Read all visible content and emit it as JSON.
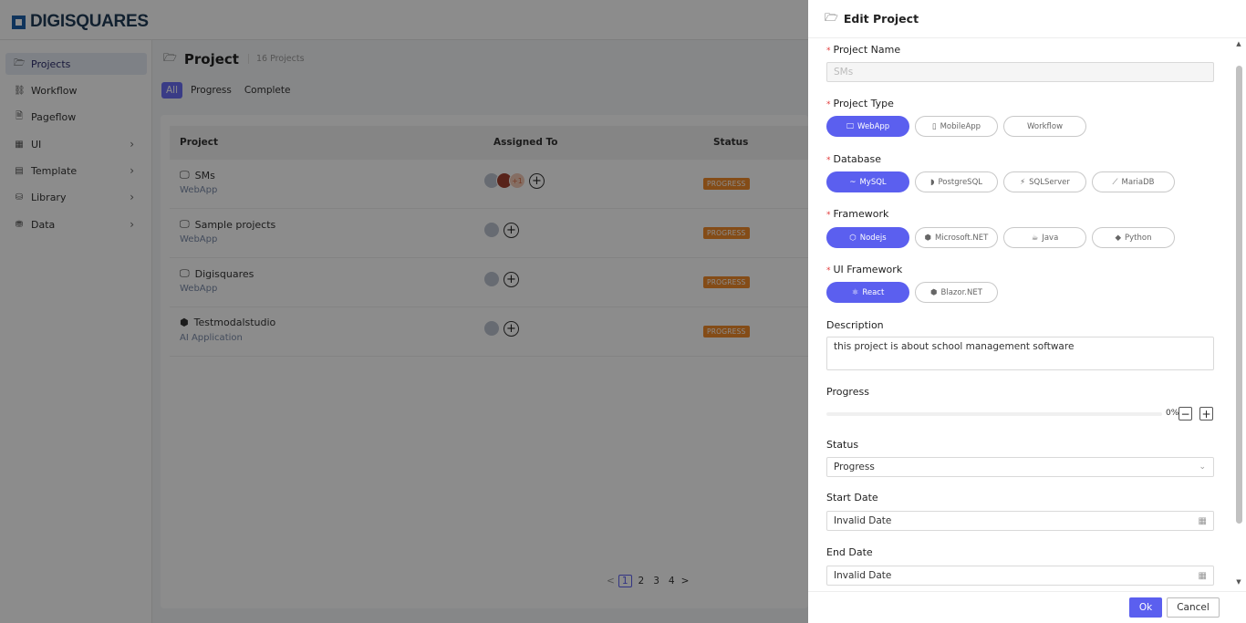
{
  "brand": {
    "name": "DIGISQUARES"
  },
  "sidebar": {
    "items": [
      {
        "label": "Projects",
        "icon": "folder-icon",
        "glyph": "🗁",
        "active": true,
        "expandable": false
      },
      {
        "label": "Workflow",
        "icon": "workflow-icon",
        "glyph": "⛓",
        "active": false,
        "expandable": false
      },
      {
        "label": "Pageflow",
        "icon": "page-icon",
        "glyph": "🗎",
        "active": false,
        "expandable": false
      },
      {
        "label": "UI",
        "icon": "ui-grid-icon",
        "glyph": "▦",
        "active": false,
        "expandable": true
      },
      {
        "label": "Template",
        "icon": "template-icon",
        "glyph": "▤",
        "active": false,
        "expandable": true
      },
      {
        "label": "Library",
        "icon": "library-icon",
        "glyph": "⛁",
        "active": false,
        "expandable": true
      },
      {
        "label": "Data",
        "icon": "database-icon",
        "glyph": "⛃",
        "active": false,
        "expandable": true
      }
    ]
  },
  "main": {
    "title": "Project",
    "count_label": "16 Projects",
    "filters": [
      "All",
      "Progress",
      "Complete"
    ],
    "table": {
      "headers": [
        "Project",
        "Assigned To",
        "Status"
      ],
      "rows": [
        {
          "name": "SMs",
          "type": "WebApp",
          "status": "PROGRESS",
          "extra_assignees": "+1"
        },
        {
          "name": "Sample projects",
          "type": "WebApp",
          "status": "PROGRESS"
        },
        {
          "name": "Digisquares",
          "type": "WebApp",
          "status": "PROGRESS"
        },
        {
          "name": "Testmodalstudio",
          "type": "AI Application",
          "status": "PROGRESS"
        }
      ]
    },
    "pagination": {
      "prev": "<",
      "pages": [
        "1",
        "2",
        "3",
        "4"
      ],
      "current": "1",
      "next": ">"
    }
  },
  "drawer": {
    "title": "Edit Project",
    "project_name": {
      "label": "Project Name",
      "placeholder": "SMs"
    },
    "project_type": {
      "label": "Project Type",
      "options": [
        "WebApp",
        "MobileApp",
        "Workflow"
      ],
      "selected": "WebApp"
    },
    "database": {
      "label": "Database",
      "options": [
        "MySQL",
        "PostgreSQL",
        "SQLServer",
        "MariaDB"
      ],
      "selected": "MySQL"
    },
    "framework": {
      "label": "Framework",
      "options": [
        "Nodejs",
        "Microsoft.NET",
        "Java",
        "Python"
      ],
      "selected": "Nodejs"
    },
    "ui_framework": {
      "label": "UI Framework",
      "options": [
        "React",
        "Blazor.NET"
      ],
      "selected": "React"
    },
    "description": {
      "label": "Description",
      "value": "this project is about school management software"
    },
    "progress": {
      "label": "Progress",
      "value_text": "0%",
      "value": 0,
      "minus": "−",
      "plus": "+"
    },
    "status": {
      "label": "Status",
      "value": "Progress"
    },
    "start_date": {
      "label": "Start Date",
      "value": "Invalid Date"
    },
    "end_date": {
      "label": "End Date",
      "value": "Invalid Date"
    },
    "ok_label": "Ok",
    "cancel_label": "Cancel"
  },
  "colors": {
    "accent": "#5b5fef",
    "status_progress": "#f08a2a",
    "brand": "#1e5fa8",
    "required": "#e23b3b"
  }
}
